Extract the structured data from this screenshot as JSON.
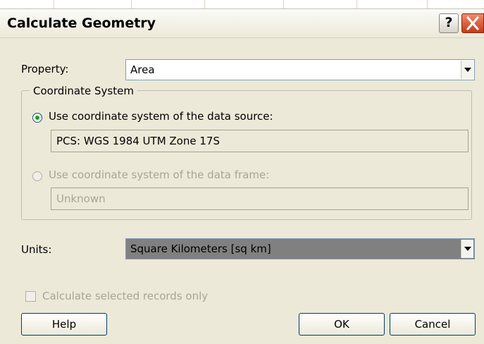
{
  "dialog": {
    "title": "Calculate Geometry"
  },
  "titlebar": {
    "help_glyph": "?",
    "close_icon": "close-x-icon"
  },
  "property": {
    "label": "Property:",
    "value": "Area"
  },
  "coordinate_system": {
    "legend": "Coordinate System",
    "source_option": {
      "label": "Use coordinate system of the data source:",
      "selected": true,
      "value": "PCS: WGS 1984 UTM Zone 17S"
    },
    "frame_option": {
      "label": "Use coordinate system of the data frame:",
      "selected": false,
      "enabled": false,
      "value": "Unknown"
    }
  },
  "units": {
    "label": "Units:",
    "value": "Square Kilometers [sq km]"
  },
  "selected_only": {
    "label": "Calculate selected records only",
    "checked": false,
    "enabled": false
  },
  "buttons": {
    "help": "Help",
    "ok": "OK",
    "cancel": "Cancel"
  },
  "colors": {
    "window_bg": "#ece9d8",
    "combo_border": "#7f9db9",
    "selected_combo": "#808080",
    "close_red": "#c63a18"
  }
}
